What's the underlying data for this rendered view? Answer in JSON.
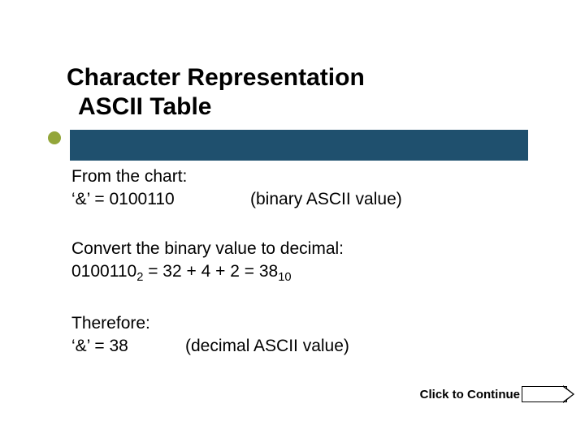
{
  "title_line1": "Character Representation",
  "title_line2": "ASCII Table",
  "body": {
    "from_chart": "From the chart:",
    "amp_binary_lhs": "‘&’ = 0100110",
    "amp_binary_note": "(binary ASCII value)",
    "convert_line": "Convert the binary value to decimal:",
    "conv_value": "0100110",
    "conv_base2": "2",
    "conv_expr_mid": "  =  32 + 4 + 2  =  38",
    "conv_base10": "10",
    "therefore": "Therefore:",
    "amp_dec_lhs": "‘&’ = 38",
    "amp_dec_note": "(decimal ASCII value)"
  },
  "cta": {
    "label": "Click to Continue"
  }
}
